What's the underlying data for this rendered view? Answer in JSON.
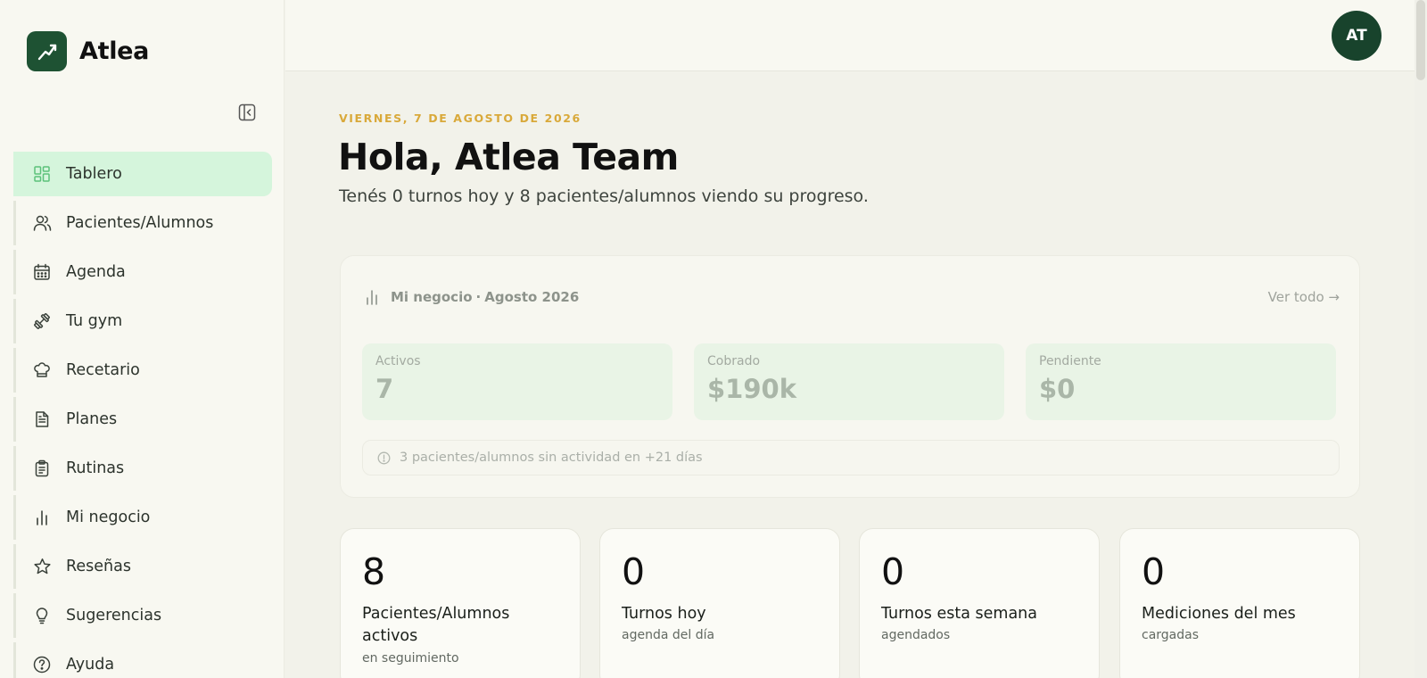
{
  "brand": {
    "name": "Atlea"
  },
  "sidebar": {
    "items": [
      {
        "label": "Tablero",
        "icon": "grid-icon",
        "active": true
      },
      {
        "label": "Pacientes/Alumnos",
        "icon": "users-icon"
      },
      {
        "label": "Agenda",
        "icon": "calendar-icon"
      },
      {
        "label": "Tu gym",
        "icon": "dumbbell-icon"
      },
      {
        "label": "Recetario",
        "icon": "chef-hat-icon"
      },
      {
        "label": "Planes",
        "icon": "document-icon"
      },
      {
        "label": "Rutinas",
        "icon": "clipboard-icon"
      },
      {
        "label": "Mi negocio",
        "icon": "bar-chart-icon"
      },
      {
        "label": "Reseñas",
        "icon": "star-icon"
      },
      {
        "label": "Sugerencias",
        "icon": "lightbulb-icon"
      },
      {
        "label": "Ayuda",
        "icon": "help-circle-icon"
      }
    ]
  },
  "topbar": {
    "avatar_initials": "AT"
  },
  "main": {
    "date": "VIERNES, 7 DE AGOSTO DE 2026",
    "greeting": "Hola, Atlea Team",
    "subtitle": "Tenés 0 turnos hoy y 8 pacientes/alumnos viendo su progreso."
  },
  "business": {
    "title": "Mi negocio",
    "separator": "·",
    "period": "Agosto 2026",
    "see_all": "Ver todo →",
    "stats": [
      {
        "label": "Activos",
        "value": "7"
      },
      {
        "label": "Cobrado",
        "value": "$190k"
      },
      {
        "label": "Pendiente",
        "value": "$0"
      }
    ],
    "alert": "3 pacientes/alumnos sin actividad en +21 días"
  },
  "metrics": [
    {
      "value": "8",
      "title": "Pacientes/Alumnos activos",
      "desc": "en seguimiento"
    },
    {
      "value": "0",
      "title": "Turnos hoy",
      "desc": "agenda del día"
    },
    {
      "value": "0",
      "title": "Turnos esta semana",
      "desc": "agendados"
    },
    {
      "value": "0",
      "title": "Mediciones del mes",
      "desc": "cargadas"
    }
  ],
  "colors": {
    "brand": "#1e5233",
    "active_nav": "#d5f5dc",
    "date_accent": "#d9a93a",
    "avatar": "#18432c"
  }
}
